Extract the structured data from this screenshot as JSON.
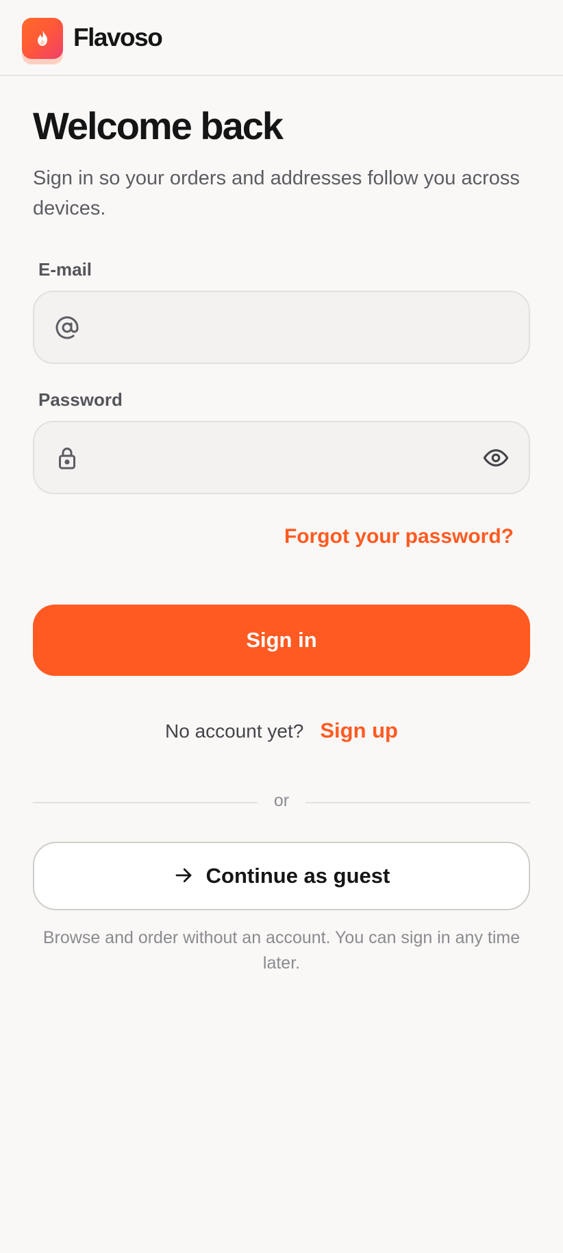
{
  "header": {
    "brand": "Flavoso",
    "logo_icon": "flame-icon"
  },
  "main": {
    "title": "Welcome back",
    "subtitle": "Sign in so your orders and addresses follow you across devices."
  },
  "form": {
    "email": {
      "label": "E-mail",
      "value": "",
      "placeholder": "",
      "icon": "at-sign-icon"
    },
    "password": {
      "label": "Password",
      "value": "",
      "placeholder": "",
      "icon": "lock-icon",
      "toggle_icon": "eye-icon"
    },
    "forgot_label": "Forgot your password?",
    "signin_label": "Sign in"
  },
  "signup": {
    "prompt": "No account yet?",
    "link_label": "Sign up"
  },
  "divider": {
    "label": "or"
  },
  "guest": {
    "button_label": "Continue as guest",
    "icon": "arrow-right-icon",
    "note": "Browse and order without an account. You can sign in any time later."
  },
  "colors": {
    "accent": "#ff5a21",
    "background": "#f9f8f6",
    "field_background": "#f3f2f0",
    "text_primary": "#151515",
    "text_secondary": "#5d5c63",
    "text_muted": "#8b8a90"
  }
}
